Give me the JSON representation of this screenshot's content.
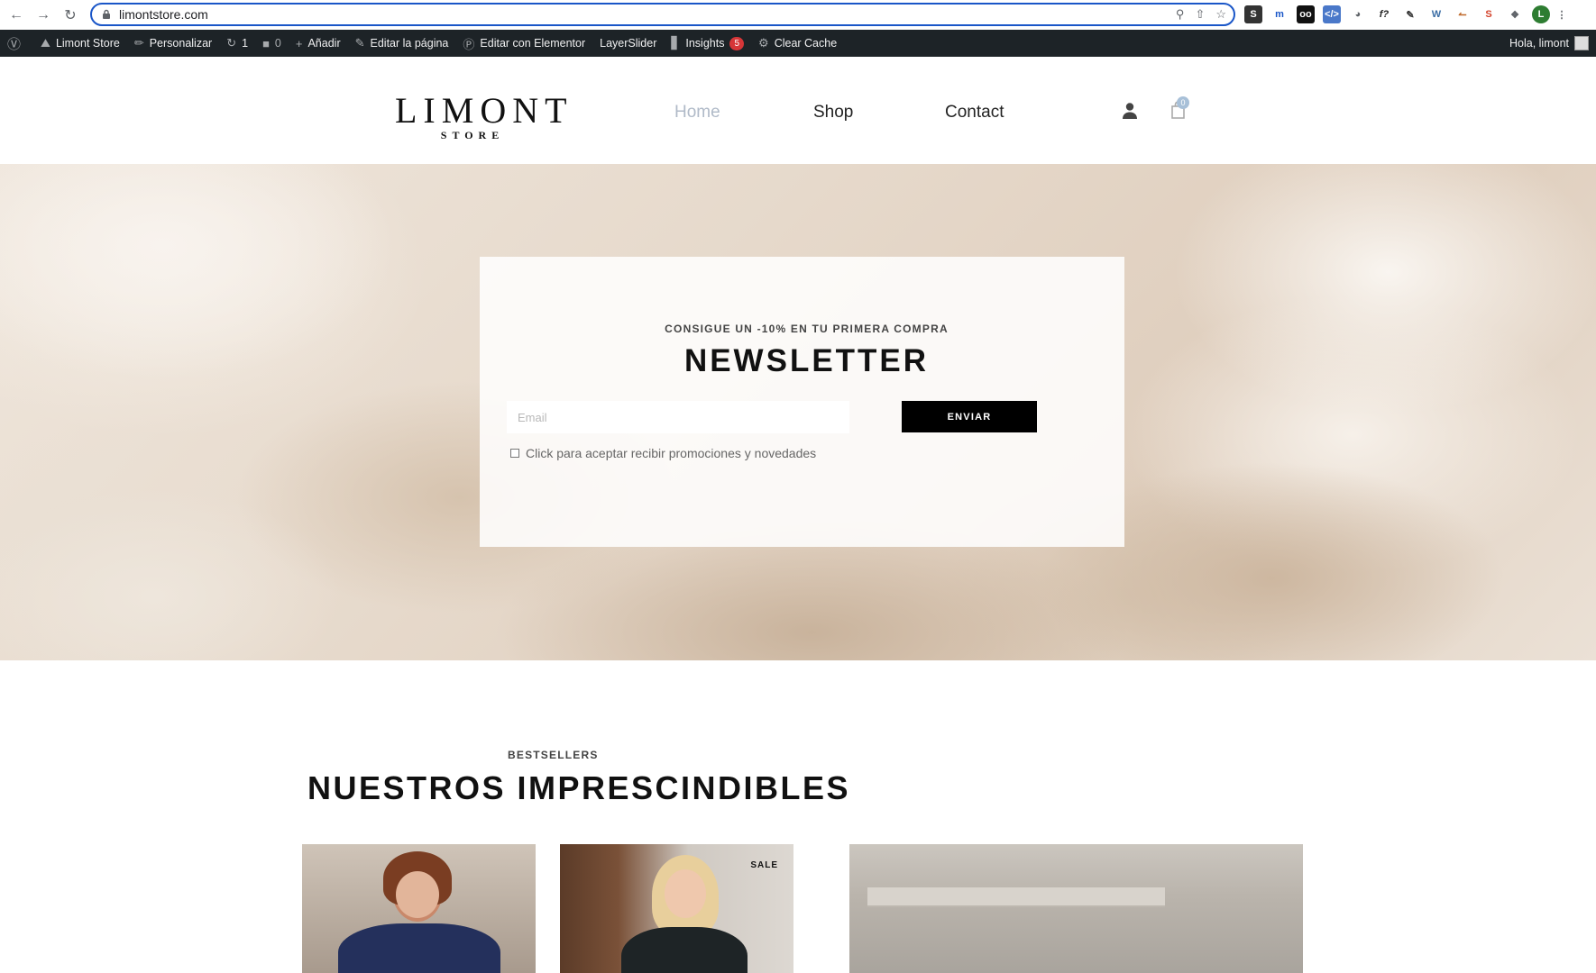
{
  "browser": {
    "url": "limontstore.com",
    "extensions": [
      "S",
      "M",
      "OO",
      "DV",
      "C",
      "f?",
      "P",
      "W",
      "T",
      "S",
      "puzzle",
      "L"
    ]
  },
  "wp_admin_bar": {
    "site_name": "Limont Store",
    "customize": "Personalizar",
    "updates_count": "1",
    "comments_count": "0",
    "add_new": "Añadir",
    "edit_page": "Editar la página",
    "edit_elementor": "Editar con Elementor",
    "layerslider": "LayerSlider",
    "insights": "Insights",
    "insights_badge": "5",
    "clear_cache": "Clear Cache",
    "greeting": "Hola, limont"
  },
  "header": {
    "logo_main": "LIMONT",
    "logo_sub": "STORE",
    "nav": [
      "Home",
      "Shop",
      "Contact"
    ],
    "cart_count": "0"
  },
  "newsletter": {
    "kicker": "CONSIGUE UN -10% EN TU PRIMERA COMPRA",
    "title": "NEWSLETTER",
    "email_placeholder": "Email",
    "button": "ENVIAR",
    "consent_label": "Click para aceptar recibir promociones y novedades"
  },
  "bestsellers": {
    "kicker": "BESTSELLERS",
    "title": "NUESTROS IMPRESCINDIBLES",
    "sale_badge": "SALE"
  },
  "colors": {
    "accent_url_border": "#1a56c8",
    "wp_bar": "#1d2327",
    "nav_active": "#b0bac8",
    "button_bg": "#000000"
  }
}
